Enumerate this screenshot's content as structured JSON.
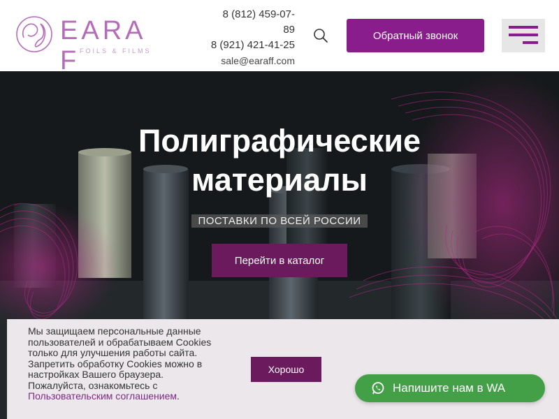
{
  "header": {
    "logo_text": "EARA F",
    "logo_sub": "FOILS & FILMS",
    "phones": [
      "8 (812) 459-07-",
      "89",
      "8 (921) 421-41-25"
    ],
    "email": "sale@earaff.com",
    "search_icon": "search-icon",
    "callback_label": "Обратный звонок",
    "menu_icon": "hamburger-menu-icon"
  },
  "hero": {
    "title_line1": "Полиграфические",
    "title_line2": "материалы",
    "subtitle": "ПОСТАВКИ ПО ВСЕЙ РОССИИ",
    "catalog_label": "Перейти в каталог"
  },
  "cookie": {
    "text_lines": [
      "Мы защищаем персональные данные",
      "пользователей и обрабатываем Cookies",
      "только для улучшения работы сайта.",
      "Запретить обработку Cookies можно в",
      "настройках Вашего браузера.",
      "Пожалуйста, ознакомьтесь с"
    ],
    "link_text": "Пользовательским соглашением",
    "link_suffix": ".",
    "accept_label": "Хорошо"
  },
  "whatsapp": {
    "label": "Напишите нам в WA",
    "icon": "whatsapp-icon"
  },
  "colors": {
    "brand": "#8a1d8c",
    "button_dark": "#6b1a5d",
    "whatsapp": "#43a047",
    "logo": "#b56bb8"
  }
}
